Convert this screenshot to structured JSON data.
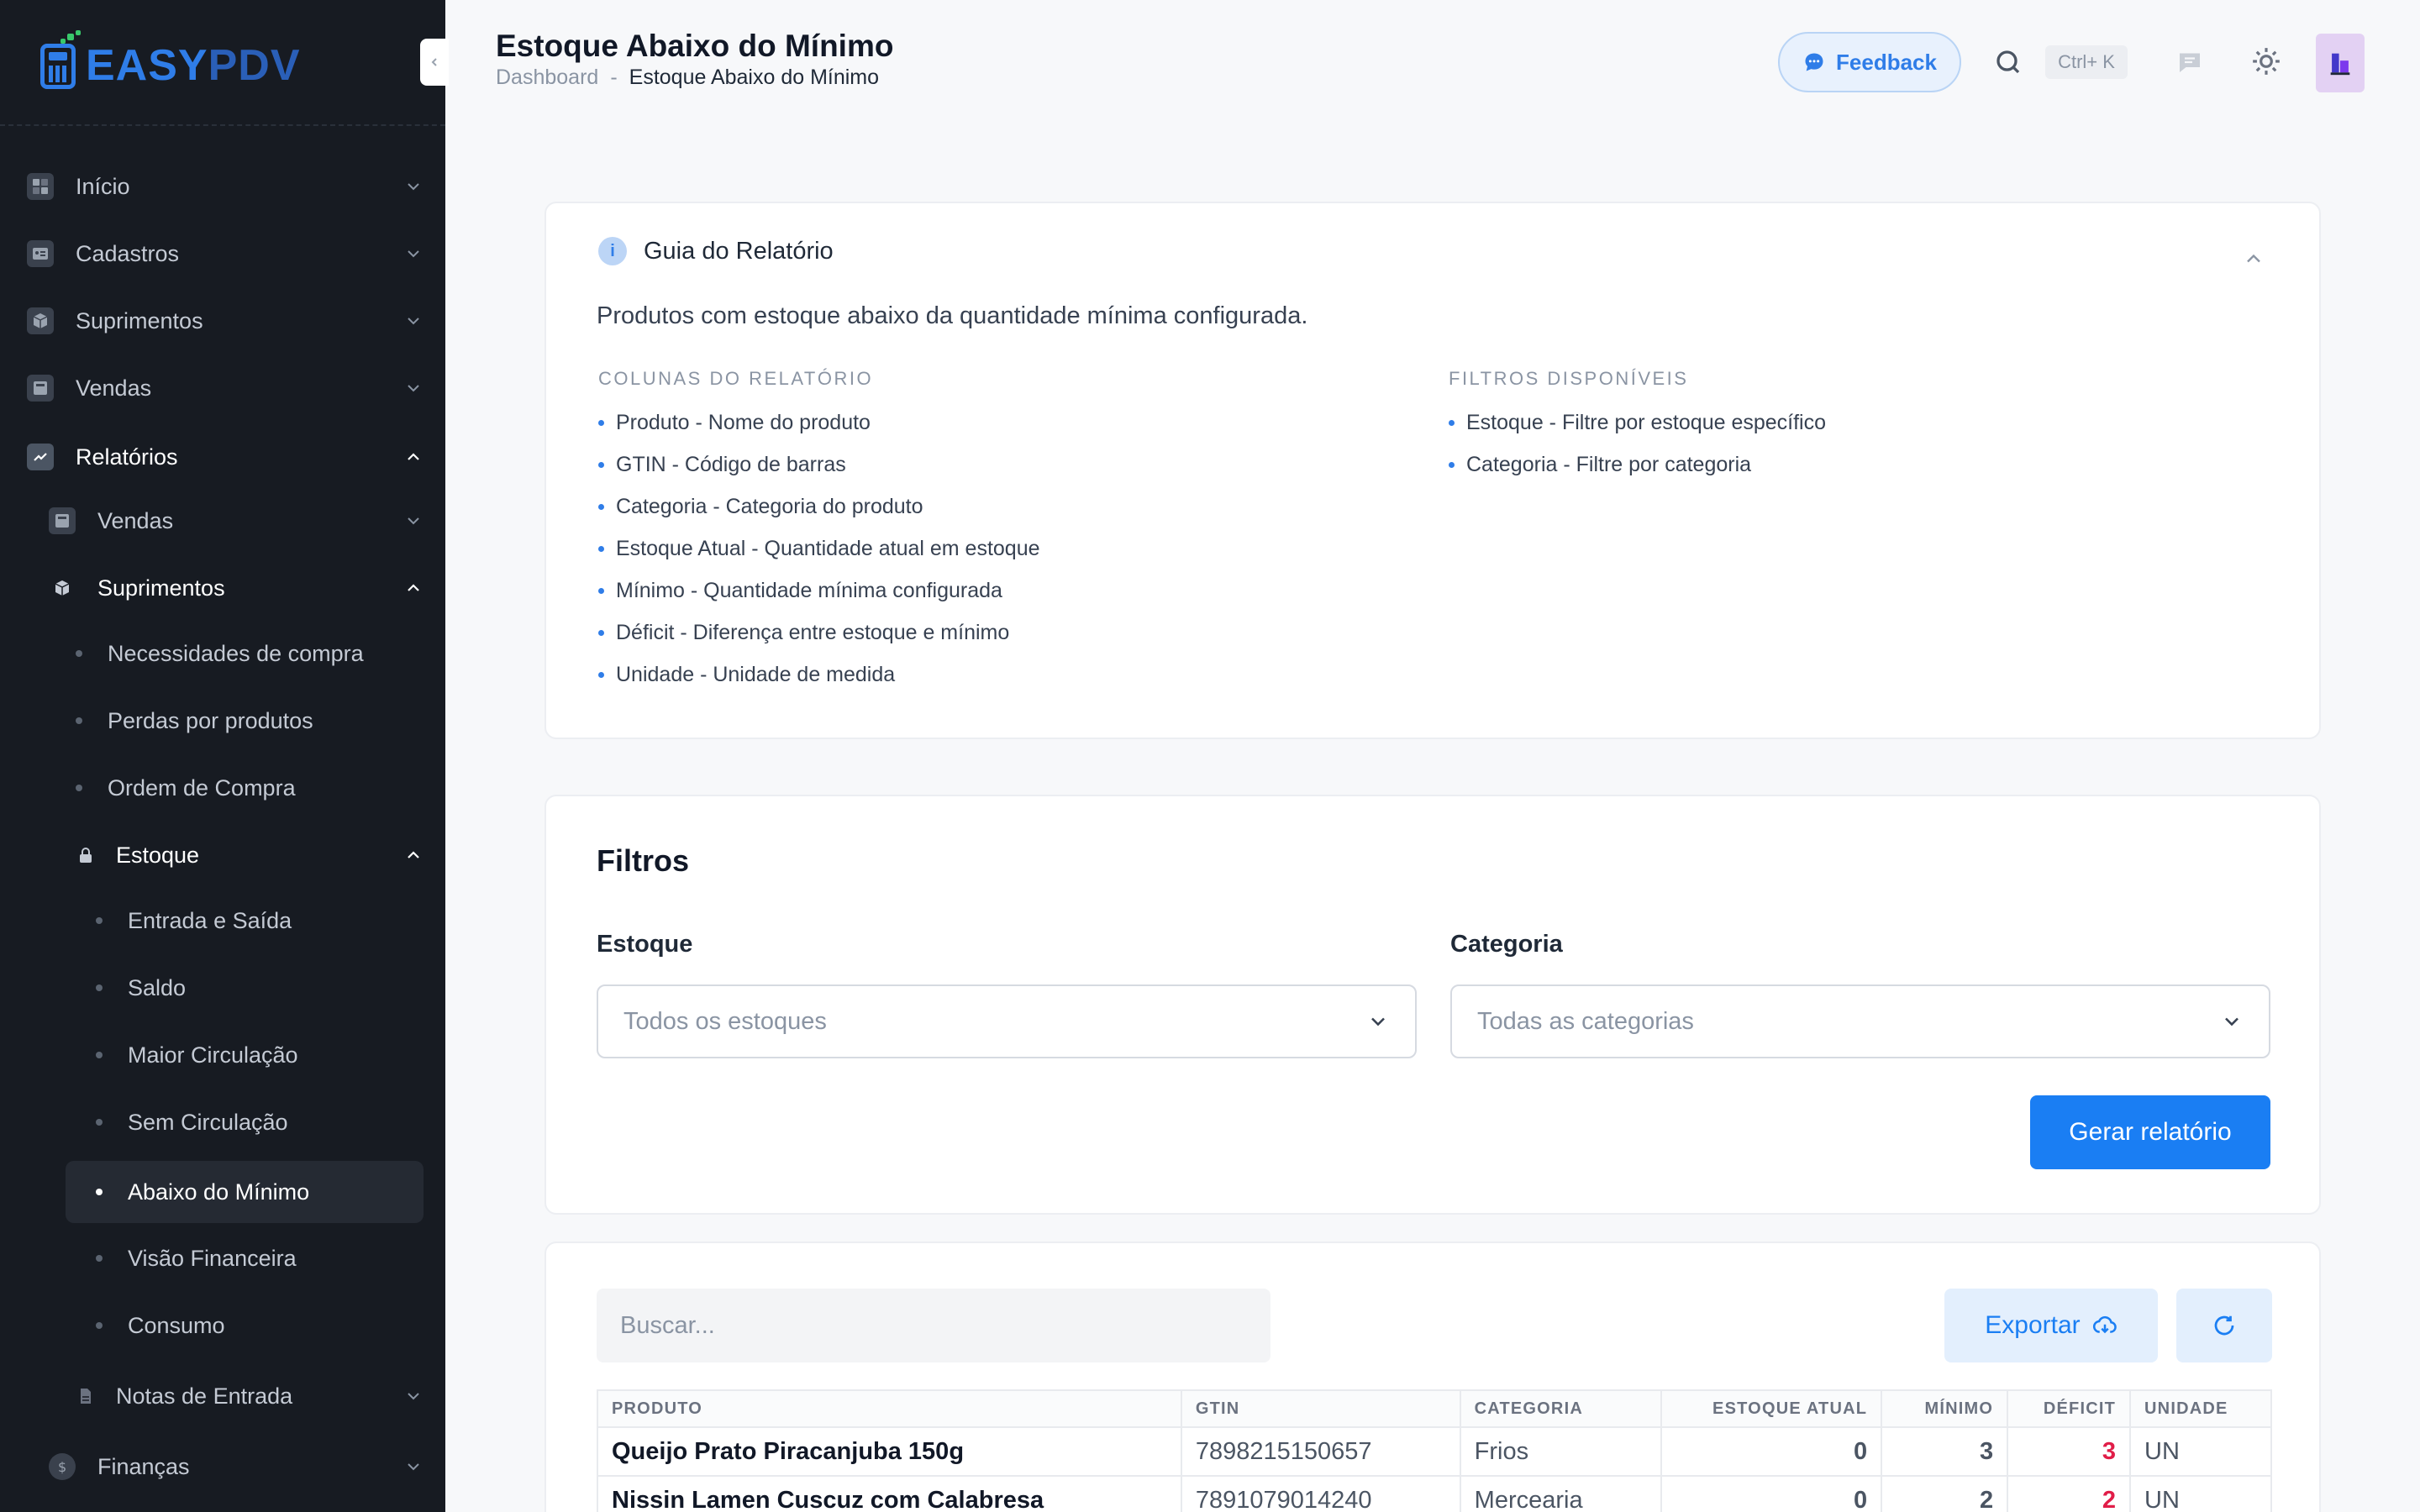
{
  "brand": {
    "part1": "EASY",
    "part2": "PDV",
    "primary": "#2f7de8"
  },
  "sidebar": {
    "items": [
      {
        "label": "Início"
      },
      {
        "label": "Cadastros"
      },
      {
        "label": "Suprimentos"
      },
      {
        "label": "Vendas"
      },
      {
        "label": "Relatórios"
      },
      {
        "label": "Vendas"
      },
      {
        "label": "Suprimentos"
      },
      {
        "label": "Necessidades de compra"
      },
      {
        "label": "Perdas por produtos"
      },
      {
        "label": "Ordem de Compra"
      },
      {
        "label": "Estoque"
      },
      {
        "label": "Entrada e Saída"
      },
      {
        "label": "Saldo"
      },
      {
        "label": "Maior Circulação"
      },
      {
        "label": "Sem Circulação"
      },
      {
        "label": "Abaixo do Mínimo"
      },
      {
        "label": "Visão Financeira"
      },
      {
        "label": "Consumo"
      },
      {
        "label": "Notas de Entrada"
      },
      {
        "label": "Finanças"
      }
    ]
  },
  "header": {
    "title": "Estoque Abaixo do Mínimo",
    "breadcrumb": {
      "root": "Dashboard",
      "separator": "-",
      "current": "Estoque Abaixo do Mínimo"
    },
    "feedback_label": "Feedback",
    "shortcut": "Ctrl+ K"
  },
  "guide": {
    "title": "Guia do Relatório",
    "description": "Produtos com estoque abaixo da quantidade mínima configurada.",
    "columns_heading": "COLUNAS DO RELATÓRIO",
    "columns": [
      "Produto - Nome do produto",
      "GTIN - Código de barras",
      "Categoria - Categoria do produto",
      "Estoque Atual - Quantidade atual em estoque",
      "Mínimo - Quantidade mínima configurada",
      "Déficit - Diferença entre estoque e mínimo",
      "Unidade - Unidade de medida"
    ],
    "filters_heading": "FILTROS DISPONÍVEIS",
    "filters": [
      "Estoque - Filtre por estoque específico",
      "Categoria - Filtre por categoria"
    ]
  },
  "filters": {
    "title": "Filtros",
    "stock_label": "Estoque",
    "stock_value": "Todos os estoques",
    "category_label": "Categoria",
    "category_value": "Todas as categorias",
    "generate_label": "Gerar relatório"
  },
  "table": {
    "search_placeholder": "Buscar...",
    "export_label": "Exportar",
    "headers": [
      "PRODUTO",
      "GTIN",
      "CATEGORIA",
      "ESTOQUE ATUAL",
      "MÍNIMO",
      "DÉFICIT",
      "UNIDADE"
    ],
    "rows": [
      [
        "Queijo Prato Piracanjuba 150g",
        "7898215150657",
        "Frios",
        "0",
        "3",
        "3",
        "UN"
      ],
      [
        "Nissin Lamen Cuscuz com Calabresa",
        "7891079014240",
        "Mercearia",
        "0",
        "2",
        "2",
        "UN"
      ]
    ]
  }
}
